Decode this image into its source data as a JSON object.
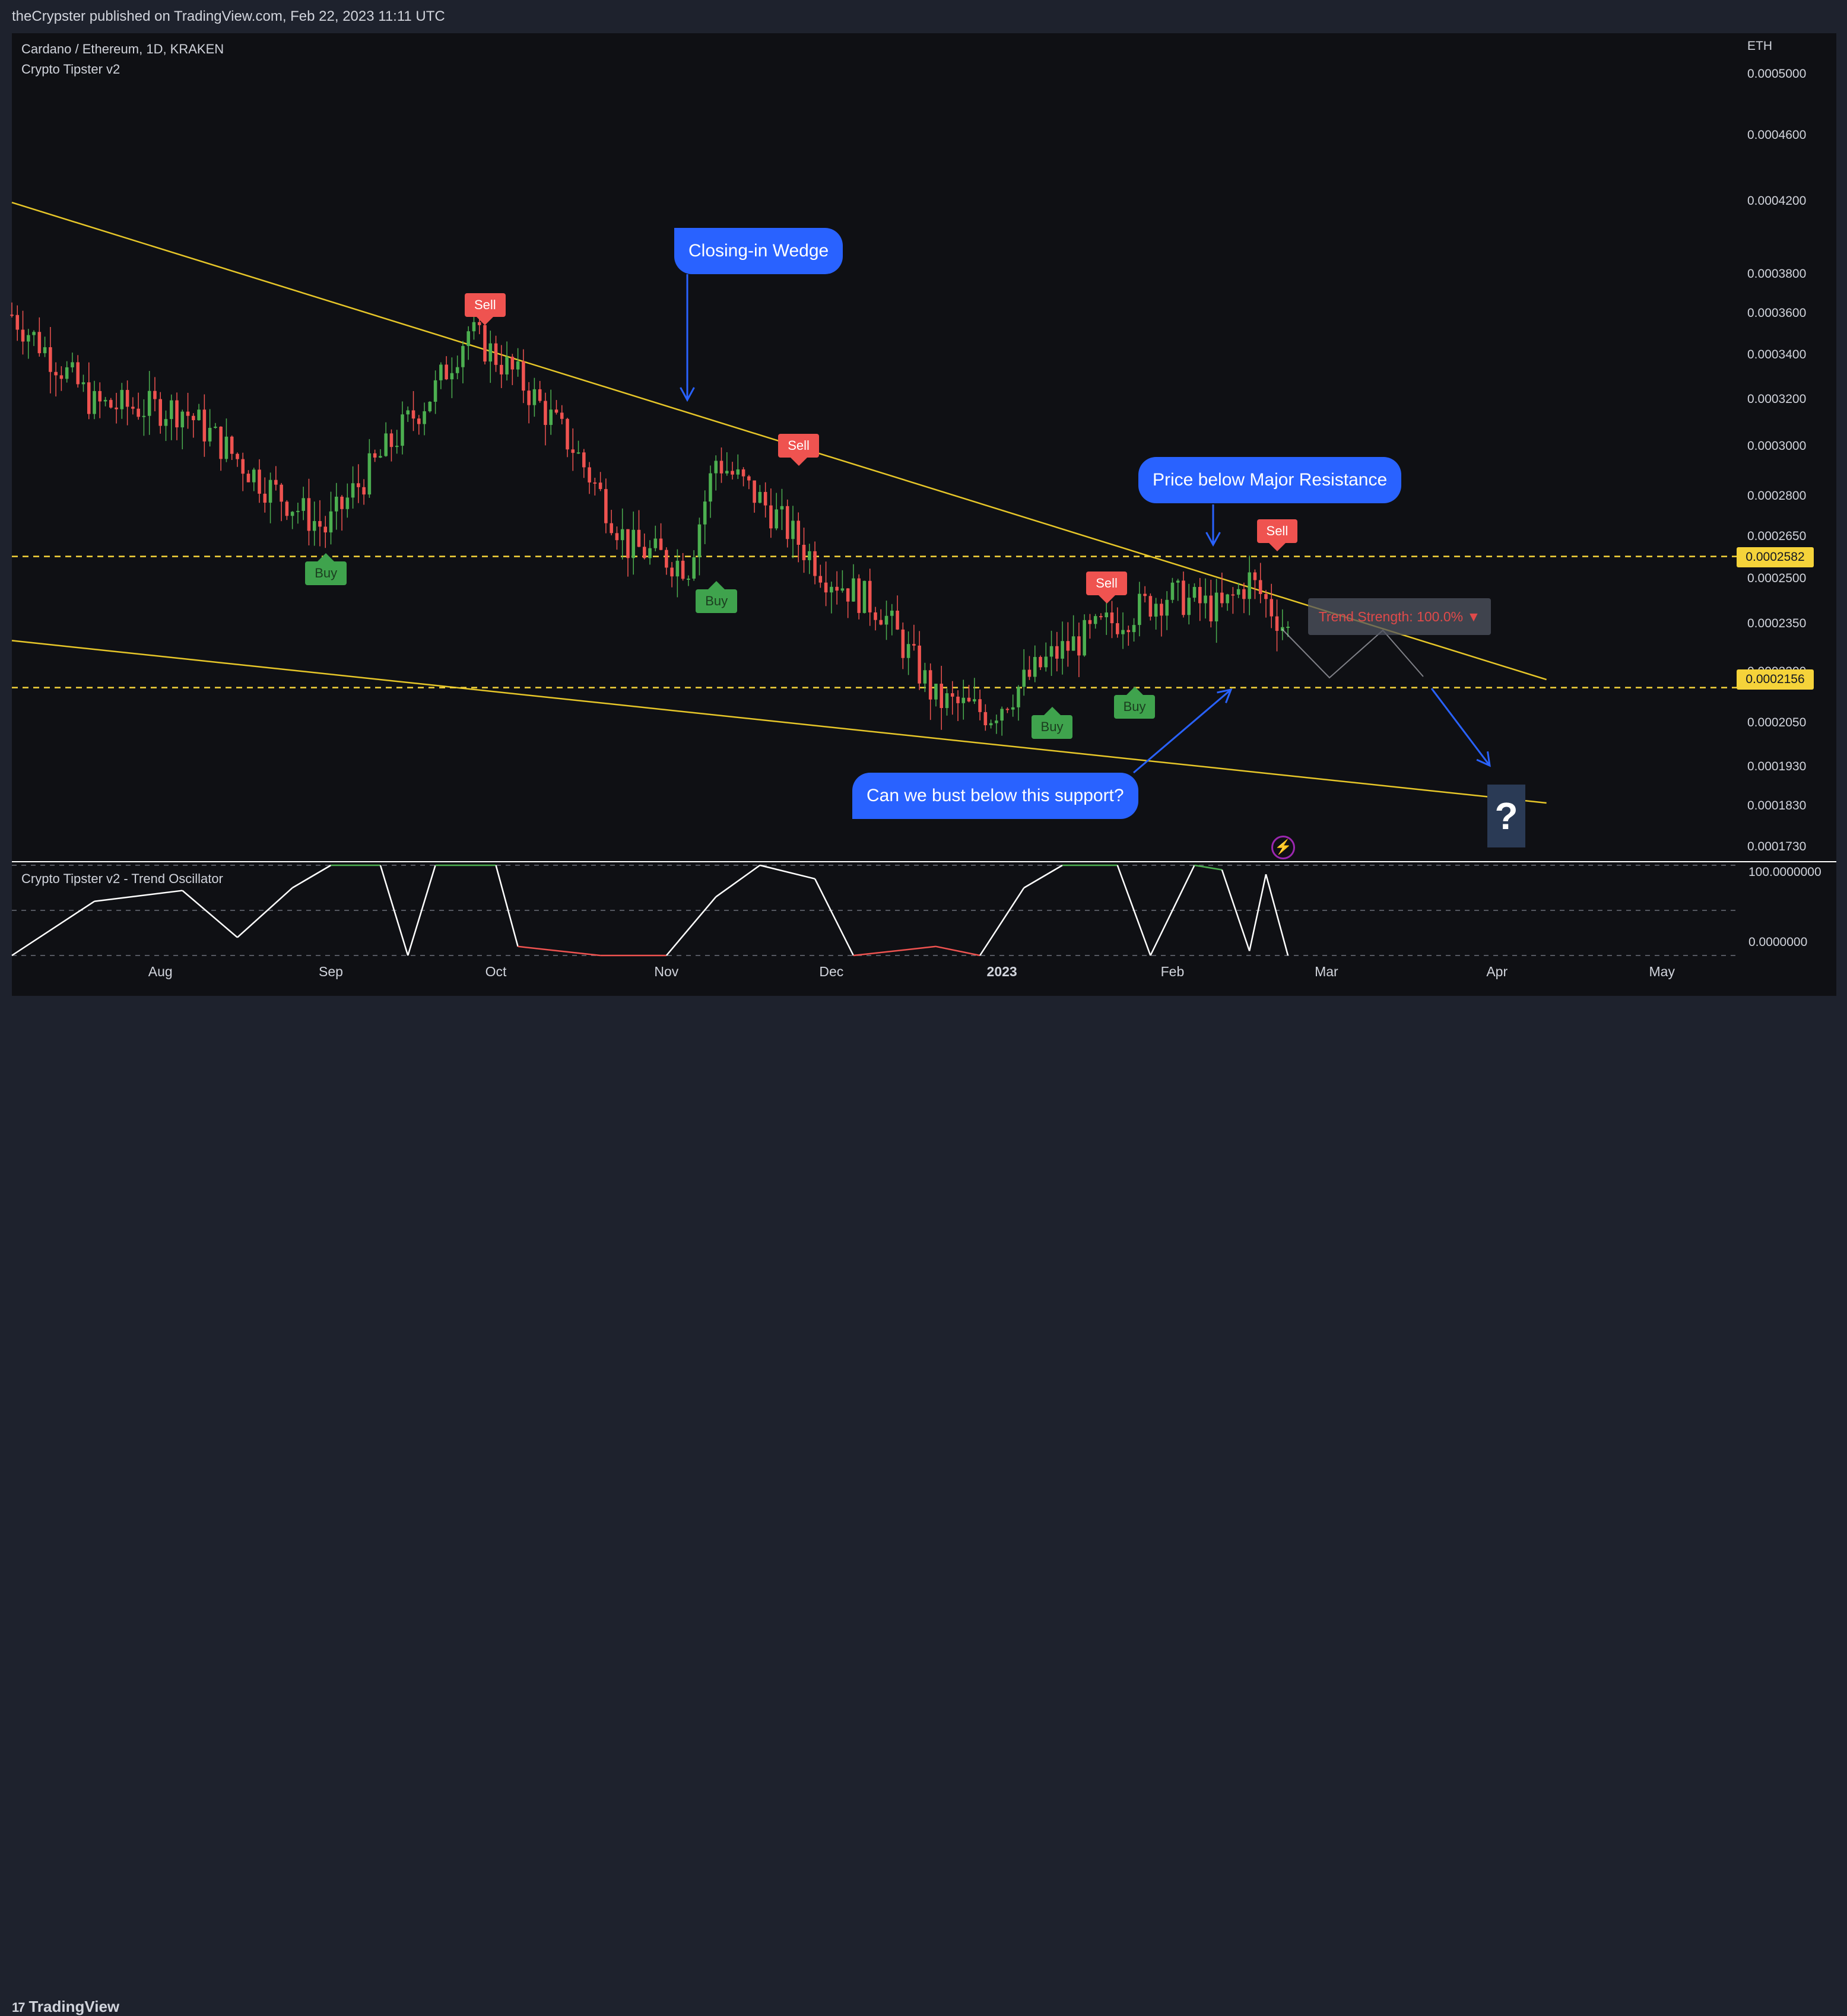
{
  "publisher_line": "theCrypster published on TradingView.com, Feb 22, 2023 11:11 UTC",
  "footer_brand": "TradingView",
  "legend": {
    "symbol": "Cardano / Ethereum, 1D, KRAKEN",
    "indicator": "Crypto Tipster v2",
    "oscillator": "Crypto Tipster v2 - Trend Oscillator"
  },
  "currency": "ETH",
  "price_axis": [
    "0.0005000",
    "0.0004600",
    "0.0004200",
    "0.0003800",
    "0.0003600",
    "0.0003400",
    "0.0003200",
    "0.0003000",
    "0.0002800",
    "0.0002650",
    "0.0002500",
    "0.0002350",
    "0.0002200",
    "0.0002050",
    "0.0001930",
    "0.0001830",
    "0.0001730"
  ],
  "price_tags": {
    "resistance": "0.0002582",
    "support": "0.0002156"
  },
  "oscillator_axis": {
    "top": "100.0000000",
    "bottom": "0.0000000"
  },
  "time_axis": [
    "Aug",
    "Sep",
    "Oct",
    "Nov",
    "Dec",
    "2023",
    "Feb",
    "Mar",
    "Apr",
    "May"
  ],
  "annotations": {
    "wedge": "Closing-in Wedge",
    "resistance": "Price below Major Resistance",
    "support": "Can we bust below this support?",
    "question": "?"
  },
  "trend_strength": "Trend Strength: 100.0% ▼",
  "signals": [
    {
      "type": "Sell",
      "label": "Sell"
    },
    {
      "type": "Sell",
      "label": "Sell"
    },
    {
      "type": "Sell",
      "label": "Sell"
    },
    {
      "type": "Sell",
      "label": "Sell"
    },
    {
      "type": "Buy",
      "label": "Buy"
    },
    {
      "type": "Buy",
      "label": "Buy"
    },
    {
      "type": "Buy",
      "label": "Buy"
    },
    {
      "type": "Buy",
      "label": "Buy"
    }
  ],
  "colors": {
    "background": "#0f1014",
    "up_candle": "#4caf50",
    "down_candle": "#ef5350",
    "trendline": "#e6c629",
    "level_line": "#f5d33a",
    "callout": "#2962ff",
    "osc_line": "#ffffff",
    "osc_high": "#4caf50",
    "osc_low": "#ef5350"
  },
  "chart_data": {
    "type": "candlestick",
    "symbol": "ADA/ETH",
    "timeframe": "1D",
    "exchange": "KRAKEN",
    "x_range": [
      "2022-07-05",
      "2023-05-15"
    ],
    "y_scale": "log",
    "y_range": [
      0.00017,
      0.00053
    ],
    "close_path": [
      {
        "date": "2022-07-05",
        "close": 0.00036
      },
      {
        "date": "2022-07-20",
        "close": 0.000318
      },
      {
        "date": "2022-08-05",
        "close": 0.000316
      },
      {
        "date": "2022-08-20",
        "close": 0.000285
      },
      {
        "date": "2022-08-31",
        "close": 0.000268
      },
      {
        "date": "2022-09-10",
        "close": 0.000296
      },
      {
        "date": "2022-09-20",
        "close": 0.000325
      },
      {
        "date": "2022-09-26",
        "close": 0.000352
      },
      {
        "date": "2022-10-05",
        "close": 0.00033
      },
      {
        "date": "2022-10-15",
        "close": 0.0003
      },
      {
        "date": "2022-10-25",
        "close": 0.000262
      },
      {
        "date": "2022-11-05",
        "close": 0.000255
      },
      {
        "date": "2022-11-10",
        "close": 0.000295
      },
      {
        "date": "2022-11-20",
        "close": 0.000275
      },
      {
        "date": "2022-11-30",
        "close": 0.000252
      },
      {
        "date": "2022-12-10",
        "close": 0.00024
      },
      {
        "date": "2022-12-20",
        "close": 0.000212
      },
      {
        "date": "2022-12-30",
        "close": 0.000208
      },
      {
        "date": "2023-01-10",
        "close": 0.000225
      },
      {
        "date": "2023-01-20",
        "close": 0.000235
      },
      {
        "date": "2023-01-31",
        "close": 0.000245
      },
      {
        "date": "2023-02-10",
        "close": 0.00024
      },
      {
        "date": "2023-02-15",
        "close": 0.00025
      },
      {
        "date": "2023-02-22",
        "close": 0.000233
      }
    ],
    "horizontal_levels": [
      {
        "name": "resistance",
        "value": 0.0002582
      },
      {
        "name": "support",
        "value": 0.0002156
      }
    ],
    "trendlines": [
      {
        "name": "upper",
        "from": {
          "date": "2022-07-05",
          "value": 0.00042
        },
        "to": {
          "date": "2023-04-10",
          "value": 0.000218
        }
      },
      {
        "name": "lower",
        "from": {
          "date": "2022-07-05",
          "value": 0.00023
        },
        "to": {
          "date": "2023-04-10",
          "value": 0.000184
        }
      }
    ],
    "signals": [
      {
        "date": "2022-09-29",
        "type": "Sell"
      },
      {
        "date": "2022-11-25",
        "type": "Sell"
      },
      {
        "date": "2023-01-20",
        "type": "Sell"
      },
      {
        "date": "2023-02-20",
        "type": "Sell"
      },
      {
        "date": "2022-08-31",
        "type": "Buy"
      },
      {
        "date": "2022-11-10",
        "type": "Buy"
      },
      {
        "date": "2023-01-10",
        "type": "Buy"
      },
      {
        "date": "2023-01-25",
        "type": "Buy"
      }
    ],
    "oscillator": {
      "name": "Crypto Tipster v2 - Trend Oscillator",
      "y_range": [
        0,
        100
      ],
      "values": [
        {
          "date": "2022-07-05",
          "value": 0
        },
        {
          "date": "2022-07-20",
          "value": 60
        },
        {
          "date": "2022-08-05",
          "value": 72
        },
        {
          "date": "2022-08-15",
          "value": 20
        },
        {
          "date": "2022-08-25",
          "value": 75
        },
        {
          "date": "2022-09-01",
          "value": 100
        },
        {
          "date": "2022-09-10",
          "value": 100
        },
        {
          "date": "2022-09-15",
          "value": 0
        },
        {
          "date": "2022-09-20",
          "value": 100
        },
        {
          "date": "2022-10-01",
          "value": 100
        },
        {
          "date": "2022-10-05",
          "value": 10
        },
        {
          "date": "2022-10-20",
          "value": 0
        },
        {
          "date": "2022-11-01",
          "value": 0
        },
        {
          "date": "2022-11-10",
          "value": 65
        },
        {
          "date": "2022-11-18",
          "value": 100
        },
        {
          "date": "2022-11-28",
          "value": 85
        },
        {
          "date": "2022-12-05",
          "value": 0
        },
        {
          "date": "2022-12-20",
          "value": 10
        },
        {
          "date": "2022-12-28",
          "value": 0
        },
        {
          "date": "2023-01-05",
          "value": 75
        },
        {
          "date": "2023-01-12",
          "value": 100
        },
        {
          "date": "2023-01-22",
          "value": 100
        },
        {
          "date": "2023-01-28",
          "value": 0
        },
        {
          "date": "2023-02-05",
          "value": 100
        },
        {
          "date": "2023-02-10",
          "value": 95
        },
        {
          "date": "2023-02-15",
          "value": 5
        },
        {
          "date": "2023-02-18",
          "value": 90
        },
        {
          "date": "2023-02-22",
          "value": 0
        }
      ]
    }
  }
}
